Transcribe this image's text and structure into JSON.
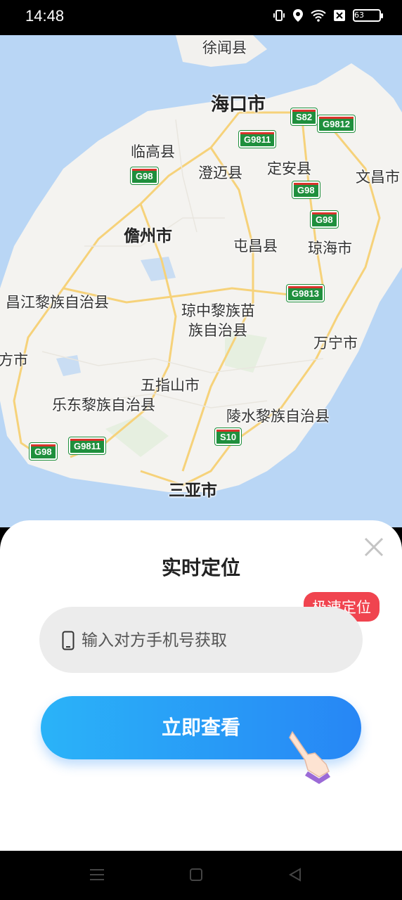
{
  "status_bar": {
    "time": "14:48",
    "battery": "63"
  },
  "map": {
    "cities": [
      {
        "key": "xuwen",
        "label": "徐闻县"
      },
      {
        "key": "haikou",
        "label": "海口市"
      },
      {
        "key": "lingao",
        "label": "临高县"
      },
      {
        "key": "chengmai",
        "label": "澄迈县"
      },
      {
        "key": "dingan",
        "label": "定安县"
      },
      {
        "key": "wenchang",
        "label": "文昌市"
      },
      {
        "key": "danzhou",
        "label": "儋州市"
      },
      {
        "key": "tunchang",
        "label": "屯昌县"
      },
      {
        "key": "qionghai",
        "label": "琼海市"
      },
      {
        "key": "changjiang",
        "label": "昌江黎族自治县"
      },
      {
        "key": "qiongzhong1",
        "label": "琼中黎族苗"
      },
      {
        "key": "qiongzhong2",
        "label": "族自治县"
      },
      {
        "key": "wanning",
        "label": "万宁市"
      },
      {
        "key": "dongfang",
        "label": "方市"
      },
      {
        "key": "wuzhishan",
        "label": "五指山市"
      },
      {
        "key": "ledong",
        "label": "乐东黎族自治县"
      },
      {
        "key": "lingshui",
        "label": "陵水黎族自治县"
      },
      {
        "key": "sanya",
        "label": "三亚市"
      }
    ],
    "shields": [
      "S82",
      "G9812",
      "G9811",
      "G98",
      "G98",
      "G98",
      "G9813",
      "S10",
      "G98",
      "G9811"
    ]
  },
  "sheet": {
    "title": "实时定位",
    "badge": "极速定位",
    "phone_placeholder": "输入对方手机号获取",
    "cta_label": "立即查看"
  }
}
